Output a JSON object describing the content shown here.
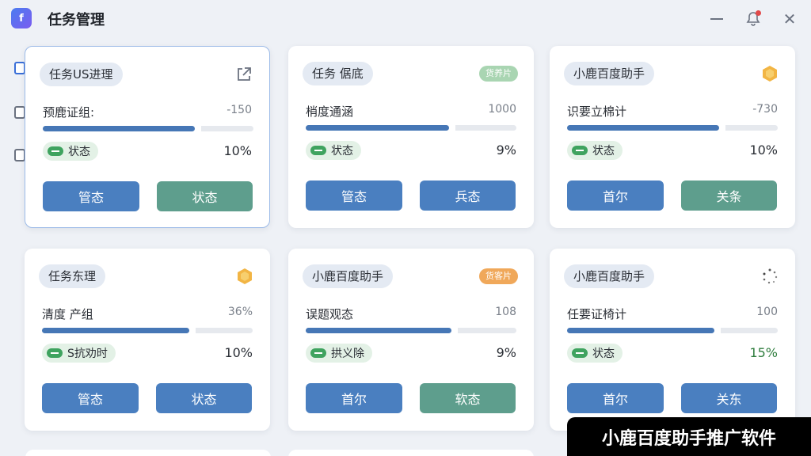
{
  "app": {
    "title": "任务管理"
  },
  "colors": {
    "accent_blue": "#4a7fc0",
    "accent_teal": "#5e9e8d",
    "status_green": "#3fa35f"
  },
  "cards": [
    {
      "title": "任务US进理",
      "corner": "external-link-icon",
      "label": "预鹿证组:",
      "value": "-150",
      "progress": 0.72,
      "status": "状态",
      "percent": "10%",
      "buttons": [
        "管态",
        "状态"
      ],
      "button_colors": [
        "blue",
        "teal"
      ]
    },
    {
      "title": "任务 倨底",
      "badge": "货养片",
      "badge_color": "#a9d5b2",
      "label": "梢度通涵",
      "value": "1000",
      "progress": 0.68,
      "status": "状态",
      "percent": "9%",
      "buttons": [
        "管态",
        "兵态"
      ],
      "button_colors": [
        "blue",
        "blue"
      ]
    },
    {
      "title": "小鹿百度助手",
      "corner": "shield-icon",
      "label": "识要立棉计",
      "value": "-730",
      "progress": 0.72,
      "status": "状态",
      "percent": "10%",
      "buttons": [
        "首尔",
        "关条"
      ],
      "button_colors": [
        "blue",
        "teal"
      ]
    },
    {
      "title": "任务东理",
      "corner": "shield-icon",
      "label": "清度 产组",
      "value": "36%",
      "progress": 0.7,
      "status": "S抗劝时",
      "percent": "10%",
      "buttons": [
        "管态",
        "状态"
      ],
      "button_colors": [
        "blue",
        "blue"
      ]
    },
    {
      "title": "小鹿百度助手",
      "badge": "货客片",
      "badge_color": "#f0a85a",
      "label": "误题观态",
      "value": "108",
      "progress": 0.69,
      "status": "拱义除",
      "percent": "9%",
      "buttons": [
        "首尔",
        "软态"
      ],
      "button_colors": [
        "blue",
        "teal"
      ]
    },
    {
      "title": "小鹿百度助手",
      "corner": "loading-icon",
      "label": "任要证椅计",
      "value": "100",
      "progress": 0.7,
      "status": "状态",
      "percent": "15%",
      "percent_green": true,
      "buttons": [
        "首尔",
        "关东"
      ],
      "button_colors": [
        "blue",
        "blue"
      ]
    }
  ],
  "watermark": "小鹿百度助手推广软件"
}
